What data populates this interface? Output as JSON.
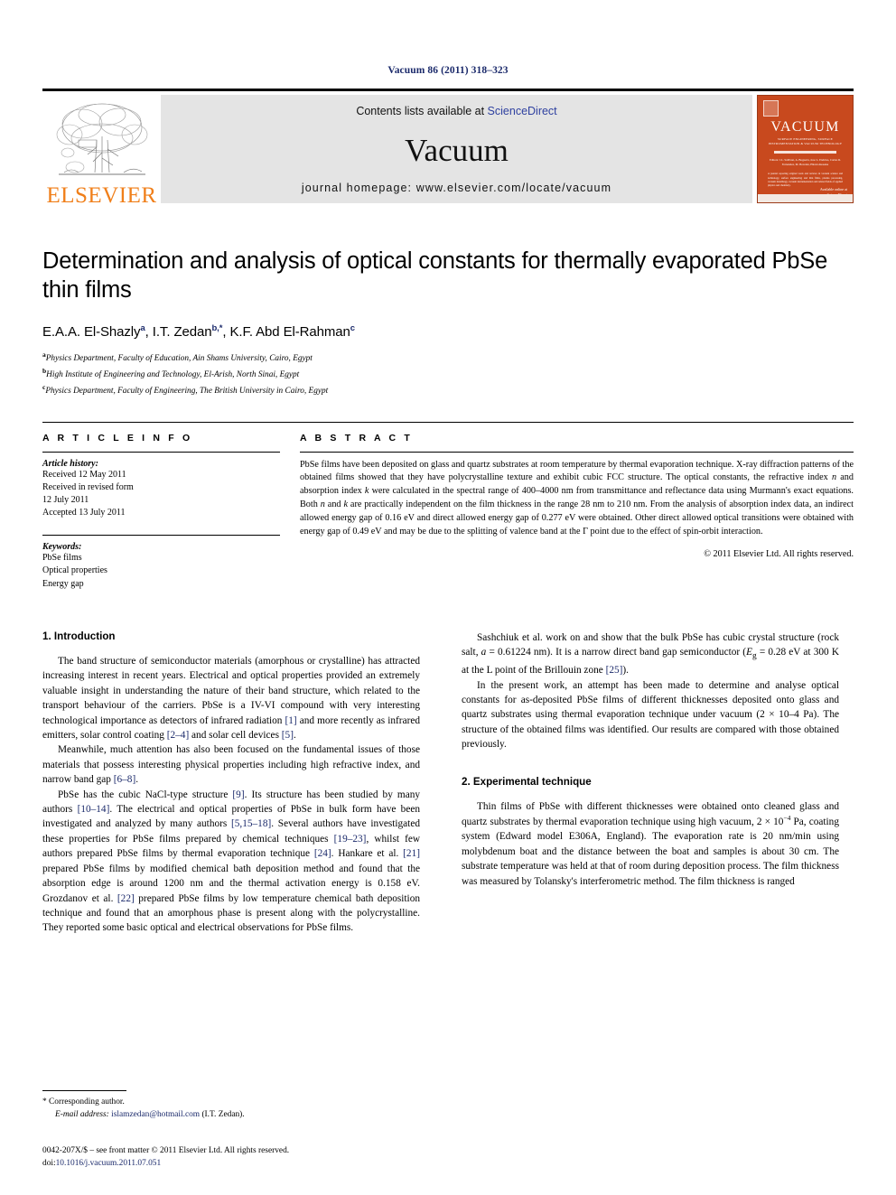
{
  "running_head": "Vacuum 86 (2011) 318–323",
  "banner": {
    "publisher_wordmark": "ELSEVIER",
    "contents_prefix": "Contents lists available at ",
    "contents_link": "ScienceDirect",
    "journal_name": "Vacuum",
    "homepage": "journal homepage: www.elsevier.com/locate/vacuum",
    "cover": {
      "title": "VACUUM",
      "subtitle": "SURFACE ENGINEERING, SURFACE INSTRUMENTATION & VACUUM TECHNOLOGY",
      "editors": "Editors: J.L. Sullivan, A. Bogaerts, Jose L. Endrino, Carlos R. Fernandez, M. Bowden, Hiroki Akasaka",
      "body": "A journal reporting original work and reviews in vacuum science and technology, surface engineering and thin films, plasma processing, vacuum metallurgy, vacuum instrumentation and related fields of applied physics and chemistry.",
      "foot_a": "Available online at",
      "foot_b": "ScienceDirect",
      "foot_c": "www.sciencedirect.com"
    }
  },
  "article": {
    "title": "Determination and analysis of optical constants for thermally evaporated PbSe thin films",
    "authors": [
      {
        "name": "E.A.A. El-Shazly",
        "marks": "a"
      },
      {
        "name": "I.T. Zedan",
        "marks": "b,*"
      },
      {
        "name": "K.F. Abd El-Rahman",
        "marks": "c"
      }
    ],
    "affiliations": [
      {
        "mark": "a",
        "text": "Physics Department, Faculty of Education, Ain Shams University, Cairo, Egypt"
      },
      {
        "mark": "b",
        "text": "High Institute of Engineering and Technology, El-Arish, North Sinai, Egypt"
      },
      {
        "mark": "c",
        "text": "Physics Department, Faculty of Engineering, The British University in Cairo, Egypt"
      }
    ]
  },
  "article_info": {
    "heading": "A R T I C L E  I N F O",
    "history_label": "Article history:",
    "history": [
      "Received 12 May 2011",
      "Received in revised form",
      "12 July 2011",
      "Accepted 13 July 2011"
    ],
    "keywords_label": "Keywords:",
    "keywords": [
      "PbSe films",
      "Optical properties",
      "Energy gap"
    ]
  },
  "abstract": {
    "heading": "A B S T R A C T",
    "text_1": "PbSe films have been deposited on glass and quartz substrates at room temperature by thermal evaporation technique. X-ray diffraction patterns of the obtained films showed that they have polycrystalline texture and exhibit cubic FCC structure. The optical constants, the refractive index ",
    "italic_n": "n",
    "text_2": " and absorption index ",
    "italic_k": "k",
    "text_3": " were calculated in the spectral range of 400–4000 nm from transmittance and reflectance data using Murmann's exact equations. Both ",
    "italic_n2": "n",
    "text_4": " and ",
    "italic_k2": "k",
    "text_5": " are practically independent on the film thickness in the range 28 nm to 210 nm. From the analysis of absorption index data, an indirect allowed energy gap of 0.16 eV and direct allowed energy gap of 0.277 eV were obtained. Other direct allowed optical transitions were obtained with energy gap of 0.49 eV and may be due to the splitting of valence band at the Γ point due to the effect of spin-orbit interaction.",
    "copyright": "© 2011 Elsevier Ltd. All rights reserved."
  },
  "sections": {
    "intro_title": "1. Introduction",
    "experimental_title": "2. Experimental technique",
    "intro_p1_a": "The band structure of semiconductor materials (amorphous or crystalline) has attracted increasing interest in recent years. Electrical and optical properties provided an extremely valuable insight in understanding the nature of their band structure, which related to the transport behaviour of the carriers. PbSe is a IV-VI compound with very interesting technological importance as detectors of infrared radiation ",
    "intro_p1_c1": "[1]",
    "intro_p1_b": " and more recently as infrared emitters, solar control coating ",
    "intro_p1_c2": "[2–4]",
    "intro_p1_c": " and solar cell devices ",
    "intro_p1_c3": "[5]",
    "intro_p1_d": ".",
    "intro_p2_a": "Meanwhile, much attention has also been focused on the fundamental issues of those materials that possess interesting physical properties including high refractive index, and narrow band gap ",
    "intro_p2_c1": "[6–8]",
    "intro_p2_b": ".",
    "intro_p3_a": "PbSe has the cubic NaCl-type structure ",
    "intro_p3_c1": "[9]",
    "intro_p3_b": ". Its structure has been studied by many authors ",
    "intro_p3_c2": "[10–14]",
    "intro_p3_c": ". The electrical and optical properties of PbSe in bulk form have been investigated and analyzed by many authors ",
    "intro_p3_c3": "[5,15–18]",
    "intro_p3_d": ". Several authors have investigated these properties for PbSe films prepared by chemical techniques ",
    "intro_p3_c4": "[19–23]",
    "intro_p3_e": ", whilst few authors prepared PbSe films by thermal evaporation technique ",
    "intro_p3_c5": "[24]",
    "intro_p3_f": ". Hankare et al. ",
    "intro_p3_c6": "[21]",
    "intro_p3_g": " prepared PbSe films by modified chemical bath deposition method and found that the absorption edge is around 1200 nm and the thermal activation energy is 0.158 eV. Grozdanov et al. ",
    "intro_p3_c7": "[22]",
    "intro_p3_h": " prepared PbSe films by low temperature chemical bath deposition technique and found that an amorphous phase is present along with the polycrystalline. They reported some basic optical and electrical observations for PbSe films.",
    "intro_p4_a": "Sashchiuk et al. work on and show that the bulk PbSe has cubic crystal structure (rock salt, ",
    "intro_p4_i1": "a",
    "intro_p4_b": " = 0.61224 nm). It is a narrow direct band gap semiconductor (",
    "intro_p4_i2": "E",
    "intro_p4_sub": "g",
    "intro_p4_c": " = 0.28 eV at 300 K at the L point of the Brillouin zone ",
    "intro_p4_c1": "[25]",
    "intro_p4_d": ").",
    "intro_p5": "In the present work, an attempt has been made to determine and analyse optical constants for as-deposited PbSe films of different thicknesses deposited onto glass and quartz substrates using thermal evaporation technique under vacuum (2 × 10–4 Pa). The structure of the obtained films was identified. Our results are compared with those obtained previously.",
    "exp_p1_a": "Thin films of PbSe with different thicknesses were obtained onto cleaned glass and quartz substrates by thermal evaporation technique using high vacuum, 2 × 10",
    "exp_p1_sup": "−4",
    "exp_p1_b": " Pa, coating system (Edward model E306A, England). The evaporation rate is 20 nm/min using molybdenum boat and the distance between the boat and samples is about 30 cm. The substrate temperature was held at that of room during deposition process. The film thickness was measured by Tolansky's interferometric method. The film thickness is ranged"
  },
  "footer": {
    "corresponding_mark": "*",
    "corresponding_text": "Corresponding author.",
    "email_label": "E-mail address:",
    "email": "islamzedan@hotmail.com",
    "email_owner": "(I.T. Zedan).",
    "issn_line": "0042-207X/$ – see front matter © 2011 Elsevier Ltd. All rights reserved.",
    "doi_label": "doi:",
    "doi_value": "10.1016/j.vacuum.2011.07.051"
  },
  "colors": {
    "link_blue": "#2f41a0",
    "citation_blue": "#1b2a6b",
    "elsevier_orange": "#F07F1A",
    "cover_orange": "#C8491E",
    "banner_gray": "#e4e4e4"
  }
}
